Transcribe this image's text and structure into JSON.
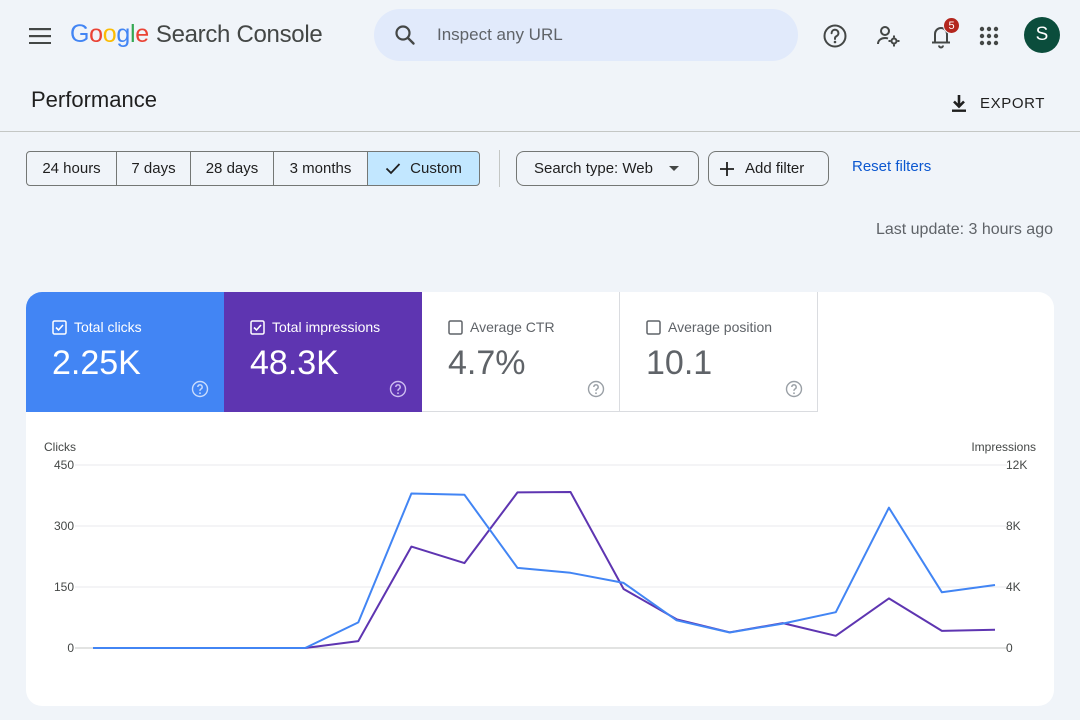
{
  "app": {
    "logo_letters": [
      "G",
      "o",
      "o",
      "g",
      "l",
      "e"
    ],
    "product_name": "Search Console"
  },
  "icons": {
    "menu": "menu-icon",
    "search": "search-icon",
    "help": "help-icon",
    "admin": "manage-accounts-icon",
    "notifications": "notifications-icon",
    "apps": "apps-grid-icon",
    "export": "download-icon"
  },
  "search": {
    "placeholder": "Inspect any URL",
    "value": ""
  },
  "notifications": {
    "count": "5"
  },
  "user": {
    "initial": "S",
    "avatar_color": "#0b4d3c"
  },
  "page": {
    "title": "Performance",
    "export_label": "EXPORT"
  },
  "filters": {
    "date_ranges": [
      "24 hours",
      "7 days",
      "28 days",
      "3 months",
      "Custom"
    ],
    "selected": "Custom",
    "search_type": "Search type: Web",
    "add_filter": "Add filter",
    "reset": "Reset filters"
  },
  "last_update": "Last update: 3 hours ago",
  "metrics": [
    {
      "label": "Total clicks",
      "value": "2.25K",
      "checked": true,
      "color": "#4285f4"
    },
    {
      "label": "Total impressions",
      "value": "48.3K",
      "checked": true,
      "color": "#5e35b1"
    },
    {
      "label": "Average CTR",
      "value": "4.7%",
      "checked": false
    },
    {
      "label": "Average position",
      "value": "10.1",
      "checked": false
    }
  ],
  "chart_data": {
    "type": "line",
    "left_axis": {
      "label": "Clicks",
      "ticks": [
        0,
        150,
        300,
        450
      ],
      "tick_labels": [
        "0",
        "150",
        "300",
        "450"
      ],
      "range": [
        0,
        450
      ]
    },
    "right_axis": {
      "label": "Impressions",
      "ticks": [
        0,
        4000,
        8000,
        12000
      ],
      "tick_labels": [
        "0",
        "4K",
        "8K",
        "12K"
      ],
      "range": [
        0,
        12000
      ]
    },
    "x": [
      0,
      1,
      2,
      3,
      4,
      5,
      6,
      7,
      8,
      9,
      10,
      11,
      12,
      13,
      14,
      15,
      16,
      17
    ],
    "grid": true,
    "series": [
      {
        "name": "Total clicks",
        "axis": "left",
        "color": "#4285f4",
        "values": [
          0,
          0,
          0,
          0,
          0,
          63,
          380,
          377,
          197,
          185,
          160,
          68,
          38,
          60,
          88,
          345,
          137,
          155
        ]
      },
      {
        "name": "Total impressions",
        "axis": "right",
        "color": "#5e35b1",
        "values": [
          0,
          0,
          0,
          0,
          0,
          450,
          6650,
          5570,
          10200,
          10230,
          3870,
          1880,
          1030,
          1630,
          800,
          3250,
          1120,
          1200
        ]
      }
    ]
  }
}
